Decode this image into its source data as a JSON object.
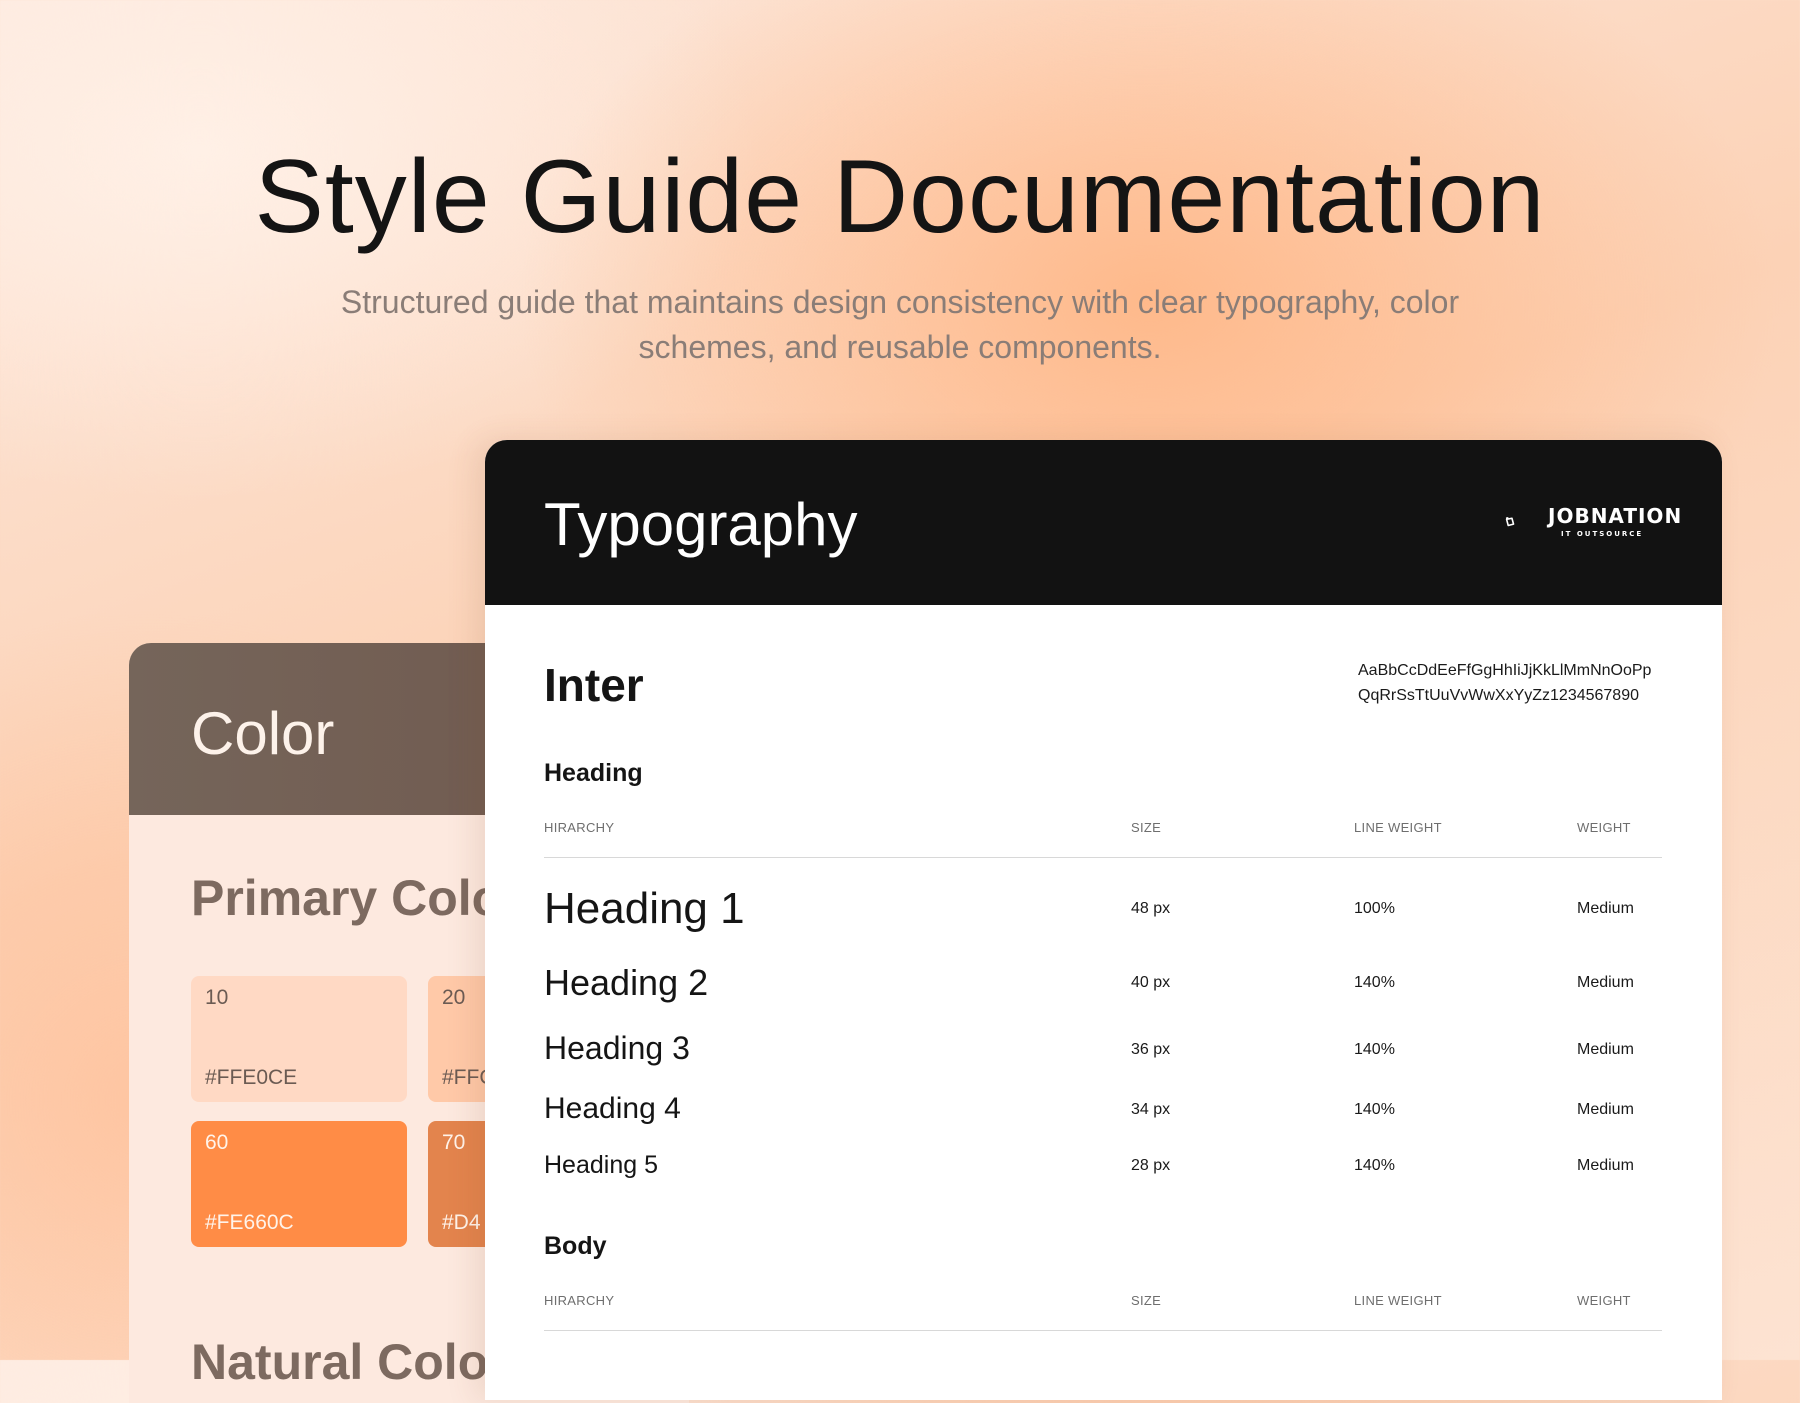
{
  "hero": {
    "title": "Style Guide Documentation",
    "subtitle": "Structured guide that maintains design consistency with clear typography, color schemes, and reusable components."
  },
  "color_card": {
    "title": "Color",
    "primary_title": "Primary Color",
    "swatches": [
      {
        "num": "10",
        "hex": "#FFE0CE",
        "bg": "#ffd9c4",
        "fg": "#6b5b53"
      },
      {
        "num": "20",
        "hex": "#FFC",
        "bg": "#ffc9a8",
        "fg": "#6b5b53"
      },
      {
        "num": "60",
        "hex": "#FE660C",
        "bg": "#ff8c46",
        "fg": "#fff3ea"
      },
      {
        "num": "70",
        "hex": "#D4",
        "bg": "#e3844d",
        "fg": "#fff3ea"
      }
    ],
    "natural_title": "Natural Color"
  },
  "typography_card": {
    "title": "Typography",
    "logo": {
      "word": "JOBNATION",
      "sub": "IT OUTSOURCE"
    },
    "font_name": "Inter",
    "glyph_line1": "AaBbCcDdEeFfGgHhIiJjKkLlMmNnOoPp",
    "glyph_line2": "QqRrSsTtUuVvWwXxYyZz1234567890",
    "heading_section": "Heading",
    "body_section": "Body",
    "columns": {
      "hierarchy": "HIRARCHY",
      "size": "SIZE",
      "line_weight": "LINE WEIGHT",
      "weight": "WEIGHT"
    },
    "rows": [
      {
        "name": "Heading 1",
        "size": "48 px",
        "line_weight": "100%",
        "weight": "Medium"
      },
      {
        "name": "Heading 2",
        "size": "40 px",
        "line_weight": "140%",
        "weight": "Medium"
      },
      {
        "name": "Heading 3",
        "size": "36 px",
        "line_weight": "140%",
        "weight": "Medium"
      },
      {
        "name": "Heading 4",
        "size": "34 px",
        "line_weight": "140%",
        "weight": "Medium"
      },
      {
        "name": "Heading 5",
        "size": "28 px",
        "line_weight": "140%",
        "weight": "Medium"
      }
    ]
  }
}
